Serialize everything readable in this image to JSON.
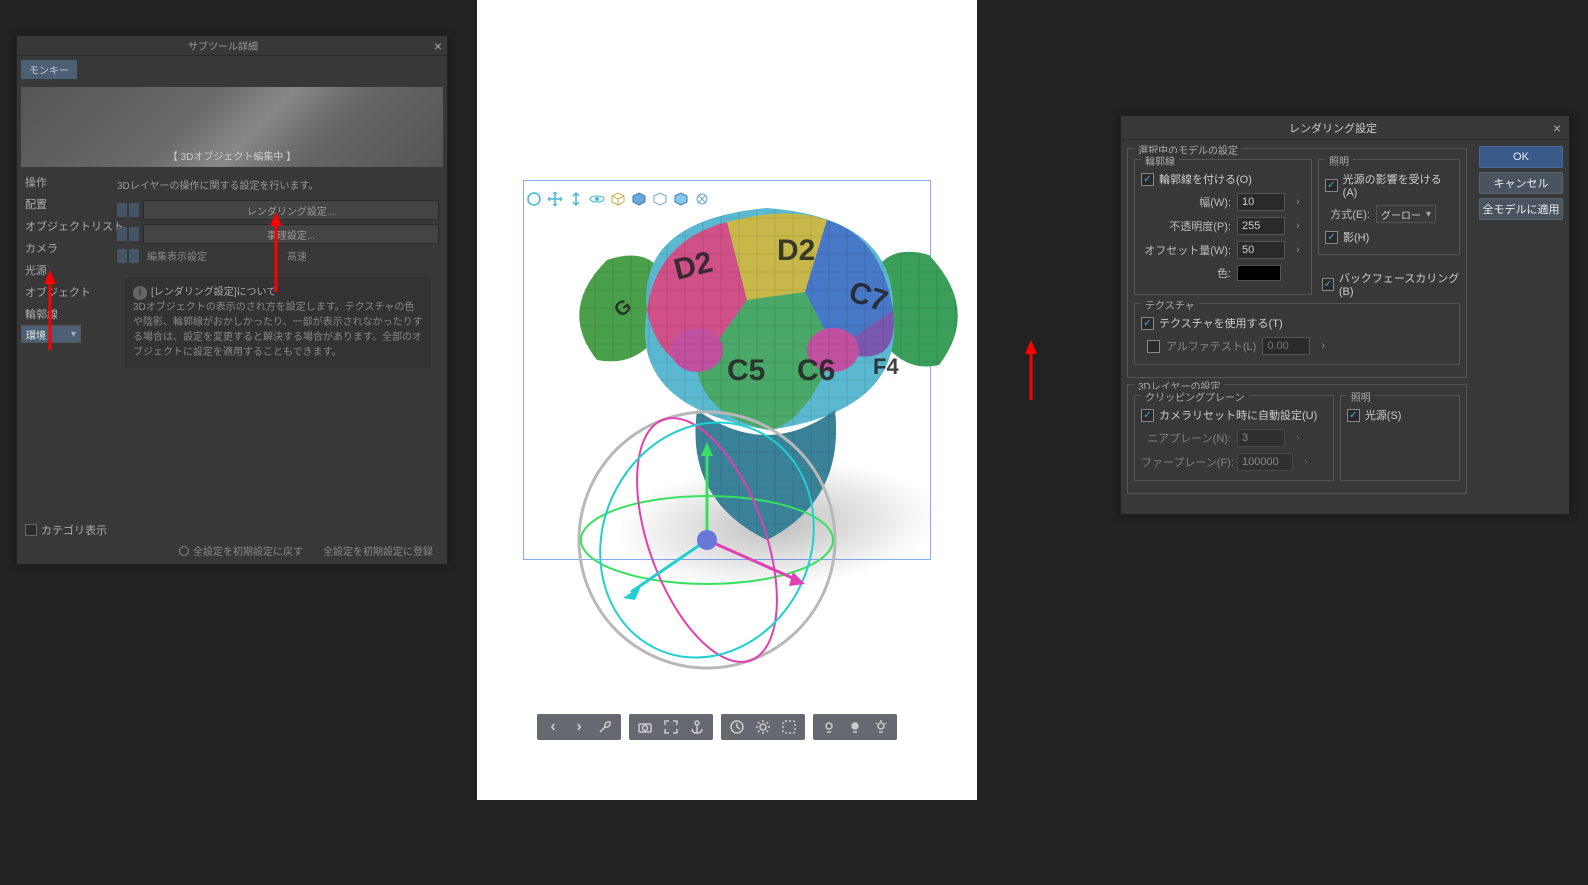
{
  "left_panel": {
    "title": "サブツール詳細",
    "tag": "モンキー",
    "preview_label": "【 3Dオブジェクト編集中 】",
    "categories": [
      "操作",
      "配置",
      "オブジェクトリスト",
      "カメラ",
      "光源",
      "オブジェクト",
      "輪郭線",
      "環境"
    ],
    "selected_cat_index": 7,
    "prop_note": "3Dレイヤーの操作に関する設定を行います。",
    "buttons": [
      "レンダリング設定...",
      "事理設定..."
    ],
    "display_label": "編集表示設定",
    "display_value": "高速",
    "info_title": "[レンダリング設定]について",
    "info_body": "3Dオブジェクトの表示のされ方を設定します。テクスチャの色や陰影、輪郭線がおかしかったり、一部が表示されなかったりする場合は、設定を変更すると解決する場合があります。全部のオブジェクトに設定を適用することもできます。",
    "cat_display": "カテゴリ表示",
    "foot1": "全設定を初期設定に戻す",
    "foot2": "全設定を初期設定に登録"
  },
  "right_panel": {
    "title": "レンダリング設定",
    "btn_ok": "OK",
    "btn_cancel": "キャンセル",
    "btn_apply_all": "全モデルに適用",
    "section_selected": "選択中のモデルの設定",
    "outline": {
      "leg": "輪郭線",
      "enable": "輪郭線を付ける(O)",
      "width_label": "幅(W):",
      "width": "10",
      "opacity_label": "不透明度(P):",
      "opacity": "255",
      "offset_label": "オフセット量(W):",
      "offset": "50",
      "color_label": "色:"
    },
    "lighting": {
      "leg": "照明",
      "receive": "光源の影響を受ける(A)",
      "method_label": "方式(E):",
      "method": "グーロー",
      "shadow": "影(H)"
    },
    "backface": "バックフェースカリング(B)",
    "texture": {
      "leg": "テクスチャ",
      "use": "テクスチャを使用する(T)",
      "alpha_label": "アルファテスト(L)",
      "alpha": "0.00"
    },
    "section_layer": "3Dレイヤーの設定",
    "clip": {
      "leg": "クリッピングプレーン",
      "auto": "カメラリセット時に自動設定(U)",
      "near_label": "ニアプレーン(N):",
      "near": "3",
      "far_label": "ファープレーン(F):",
      "far": "100000"
    },
    "lighting2": {
      "leg": "照明",
      "light": "光源(S)"
    }
  },
  "toolbar": {
    "prev": "‹",
    "next": "›"
  }
}
